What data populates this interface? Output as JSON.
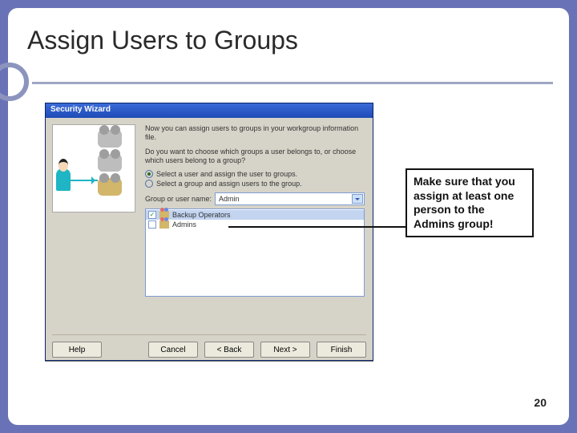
{
  "slide": {
    "title": "Assign Users to Groups",
    "page_number": "20"
  },
  "callout": {
    "text": "Make sure that you assign at least one person to the Admins group!"
  },
  "wizard": {
    "title": "Security Wizard",
    "intro1": "Now you can assign users to groups in your workgroup information file.",
    "intro2": "Do you want to choose which groups a user belongs to, or choose which users belong to a group?",
    "radio1": "Select a user and assign the user to groups.",
    "radio2": "Select a group and assign users to the group.",
    "field_label": "Group or user name:",
    "selected_user": "Admin",
    "list_items": [
      {
        "label": "Backup Operators",
        "checked": true
      },
      {
        "label": "Admins",
        "checked": false
      }
    ],
    "buttons": {
      "help": "Help",
      "cancel": "Cancel",
      "back": "< Back",
      "next": "Next >",
      "finish": "Finish"
    }
  }
}
